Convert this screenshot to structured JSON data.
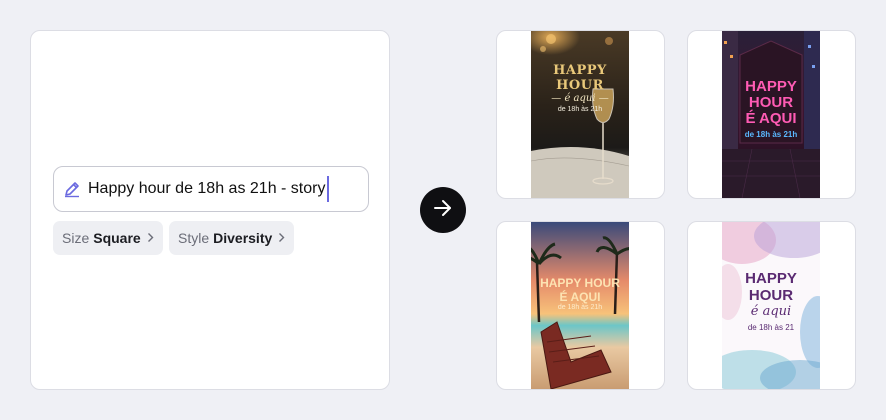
{
  "prompt": {
    "text": "Happy hour de 18h as 21h - story"
  },
  "options": {
    "size_key": "Size",
    "size_value": "Square",
    "style_key": "Style",
    "style_value": "Diversity"
  },
  "results": [
    {
      "line1": "HAPPY HOUR",
      "line2": "— é aqui —",
      "line3": "de 18h às 21h"
    },
    {
      "line1": "HAPPY",
      "line2": "HOUR",
      "line3": "É AQUI",
      "line4": "de 18h às 21h"
    },
    {
      "line1": "HAPPY HOUR",
      "line2": "É AQUI",
      "line3": "de 18h às 21h"
    },
    {
      "line1": "HAPPY",
      "line2": "HOUR",
      "line3": "é aqui",
      "line4": "de 18h às 21"
    }
  ],
  "icons": {
    "prompt": "pencil-icon",
    "generate": "arrow-right-icon",
    "chevron": "chevron-right-icon"
  },
  "colors": {
    "accent_caret": "#6b6ae0",
    "generate_button": "#0f0f12"
  }
}
